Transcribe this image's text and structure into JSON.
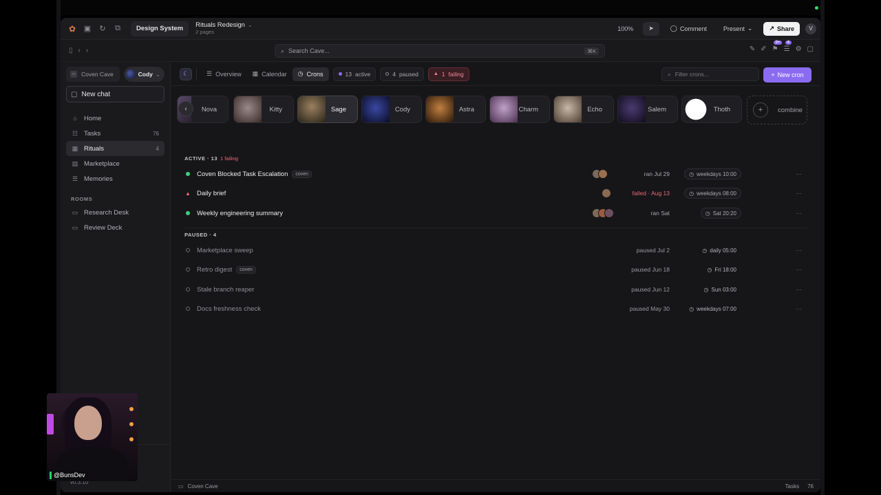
{
  "titlebar": {
    "workspace": "Design System",
    "doc_title": "Rituals Redesign",
    "doc_sub": "2 pages",
    "zoom": "100%",
    "comment": "Comment",
    "present": "Present",
    "share": "Share",
    "avatar": "V"
  },
  "address": {
    "search_placeholder": "Search Cave...",
    "shortcut": "⌘K",
    "badge_a": "9+",
    "badge_b": "4"
  },
  "sidebar": {
    "workspace": "Coven Cave",
    "user": "Cody",
    "new_chat": "New chat",
    "items": [
      {
        "label": "Home",
        "count": ""
      },
      {
        "label": "Tasks",
        "count": "76"
      },
      {
        "label": "Rituals",
        "count": "4"
      },
      {
        "label": "Marketplace",
        "count": ""
      },
      {
        "label": "Memories",
        "count": ""
      }
    ],
    "rooms_label": "ROOMS",
    "rooms": [
      {
        "label": "Research Desk"
      },
      {
        "label": "Review Deck"
      }
    ],
    "version": "v0.3.10"
  },
  "tabs": {
    "items": [
      {
        "label": "Overview"
      },
      {
        "label": "Calendar"
      },
      {
        "label": "Crons"
      }
    ],
    "active_count": "13",
    "active_label": "active",
    "paused_count": "4",
    "paused_label": "paused",
    "failing_count": "1",
    "failing_label": "failing",
    "filter_placeholder": "Filter crons...",
    "new_cron": "New cron"
  },
  "agents": [
    {
      "name": "Nova",
      "color": "#5a4a6a"
    },
    {
      "name": "Kitty",
      "color": "#6a5a5a"
    },
    {
      "name": "Sage",
      "color": "#4a4a3a"
    },
    {
      "name": "Cody",
      "color": "#1a2060"
    },
    {
      "name": "Astra",
      "color": "#7a4a20"
    },
    {
      "name": "Charm",
      "color": "#8a6a90"
    },
    {
      "name": "Echo",
      "color": "#8a7a70"
    },
    {
      "name": "Salem",
      "color": "#2a2040"
    },
    {
      "name": "Thoth",
      "color": "#f0f0f0"
    }
  ],
  "combine": "combine",
  "active_section": {
    "label": "ACTIVE · 13",
    "failing": "1 failing",
    "rows": [
      {
        "name": "Coven Blocked Task Escalation",
        "tag": "coven",
        "status": "ran Jul 29",
        "schedule": "weekdays 10:00",
        "state": "ok"
      },
      {
        "name": "Daily brief",
        "tag": "",
        "status": "failed · Aug 13",
        "schedule": "weekdays 08:00",
        "state": "failed"
      },
      {
        "name": "Weekly engineering summary",
        "tag": "",
        "status": "ran Sat",
        "schedule": "Sat 20:20",
        "state": "ok"
      }
    ]
  },
  "paused_section": {
    "label": "PAUSED · 4",
    "rows": [
      {
        "name": "Marketplace sweep",
        "tag": "",
        "status": "paused Jul 2",
        "schedule": "daily 05:00"
      },
      {
        "name": "Retro digest",
        "tag": "coven",
        "status": "paused Jun 18",
        "schedule": "Fri 18:00"
      },
      {
        "name": "Stale branch reaper",
        "tag": "",
        "status": "paused Jun 12",
        "schedule": "Sun 03:00"
      },
      {
        "name": "Docs freshness check",
        "tag": "",
        "status": "paused May 30",
        "schedule": "weekdays 07:00"
      }
    ]
  },
  "footer": {
    "location": "Coven Cave",
    "tasks_label": "Tasks",
    "tasks_count": "76"
  },
  "overlay": {
    "handle": "@BunsDev"
  }
}
